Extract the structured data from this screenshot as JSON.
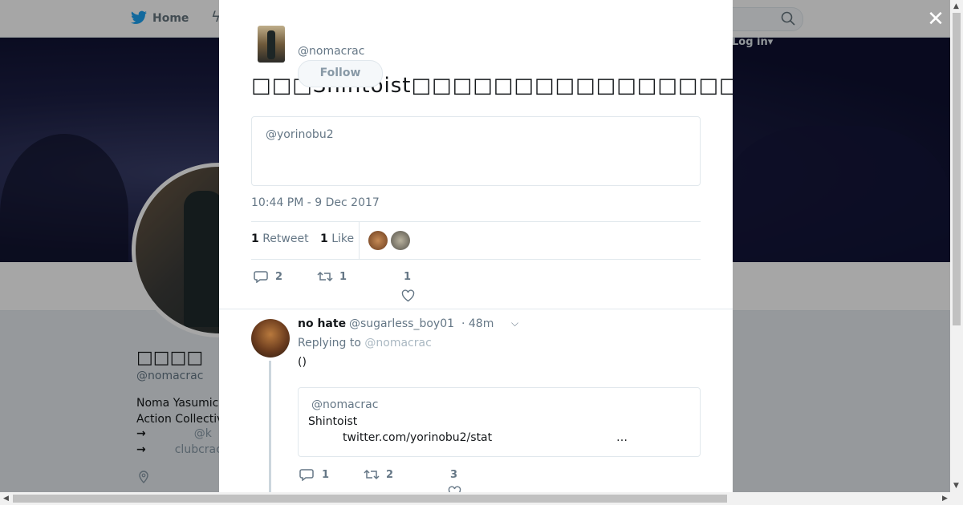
{
  "nav": {
    "home_label": "Home",
    "login_label": "Log in"
  },
  "profile": {
    "name": "□□□□",
    "handle": "@nomacrac",
    "bio_line1": "Noma Yasumic",
    "bio_line2": "Action Collectiv",
    "link1_arrow": "→",
    "link1_text": "@k",
    "link2_arrow": "→",
    "link2_text": "clubcrac"
  },
  "modal": {
    "author_handle": "@nomacrac",
    "follow_label": "Follow",
    "tweet_text_prefix": "□□□Shintoist□□□□□□□□□□□□□□□□□□□□□□□□□□□□□□□□□□□□□",
    "quoted_handle": "@yorinobu2",
    "timestamp": "10:44 PM - 9 Dec 2017",
    "retweet_count": "1",
    "retweet_label": "Retweet",
    "like_count": "1",
    "like_label": "Like",
    "actions": {
      "replies": "2",
      "retweets": "1",
      "likes": "1"
    }
  },
  "reply": {
    "name": "no hate",
    "handle": "@sugarless_boy01",
    "time": "· 48m",
    "replying_prefix": "Replying to",
    "replying_to": "@nomacrac",
    "text": "()",
    "quote_handle": "@nomacrac",
    "quote_text": "Shintoist",
    "quote_link": "twitter.com/yorinobu2/stat",
    "quote_ellipsis": "…",
    "actions": {
      "replies": "1",
      "retweets": "2",
      "likes": "3"
    }
  },
  "colors": {
    "accent": "#1da1f2",
    "muted": "#657786",
    "border": "#e1e8ed"
  }
}
